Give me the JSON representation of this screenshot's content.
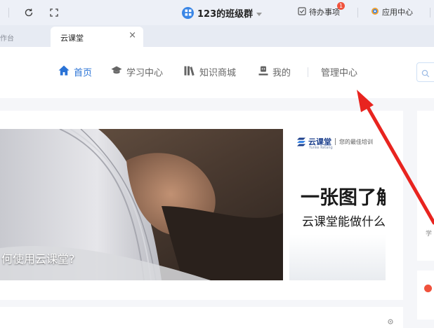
{
  "topbar": {
    "group_name": "123的班级群",
    "todo_label": "待办事项",
    "todo_badge": "1",
    "apps_label": "应用中心"
  },
  "tabs": {
    "previous_tab": "作台",
    "active_tab": "云课堂"
  },
  "nav": {
    "items": [
      {
        "label": "首页",
        "icon": "home-icon",
        "active": true
      },
      {
        "label": "学习中心",
        "icon": "graduation-cap-icon",
        "active": false
      },
      {
        "label": "知识商城",
        "icon": "books-icon",
        "active": false
      },
      {
        "label": "我的",
        "icon": "user-icon",
        "active": false
      },
      {
        "label": "管理中心",
        "icon": "",
        "active": false
      }
    ]
  },
  "banner": {
    "caption": "何使用云课堂?"
  },
  "ad": {
    "logo_text": "云课堂",
    "slogan": "您的最佳培训",
    "logo_sub": "Yunke Ketang",
    "headline": "一张图了解",
    "subline": "云课堂能做什么"
  },
  "side": {
    "text": "学"
  },
  "colors": {
    "accent": "#2a73d6",
    "arrow": "#e8241f",
    "badge": "#f0523c"
  }
}
